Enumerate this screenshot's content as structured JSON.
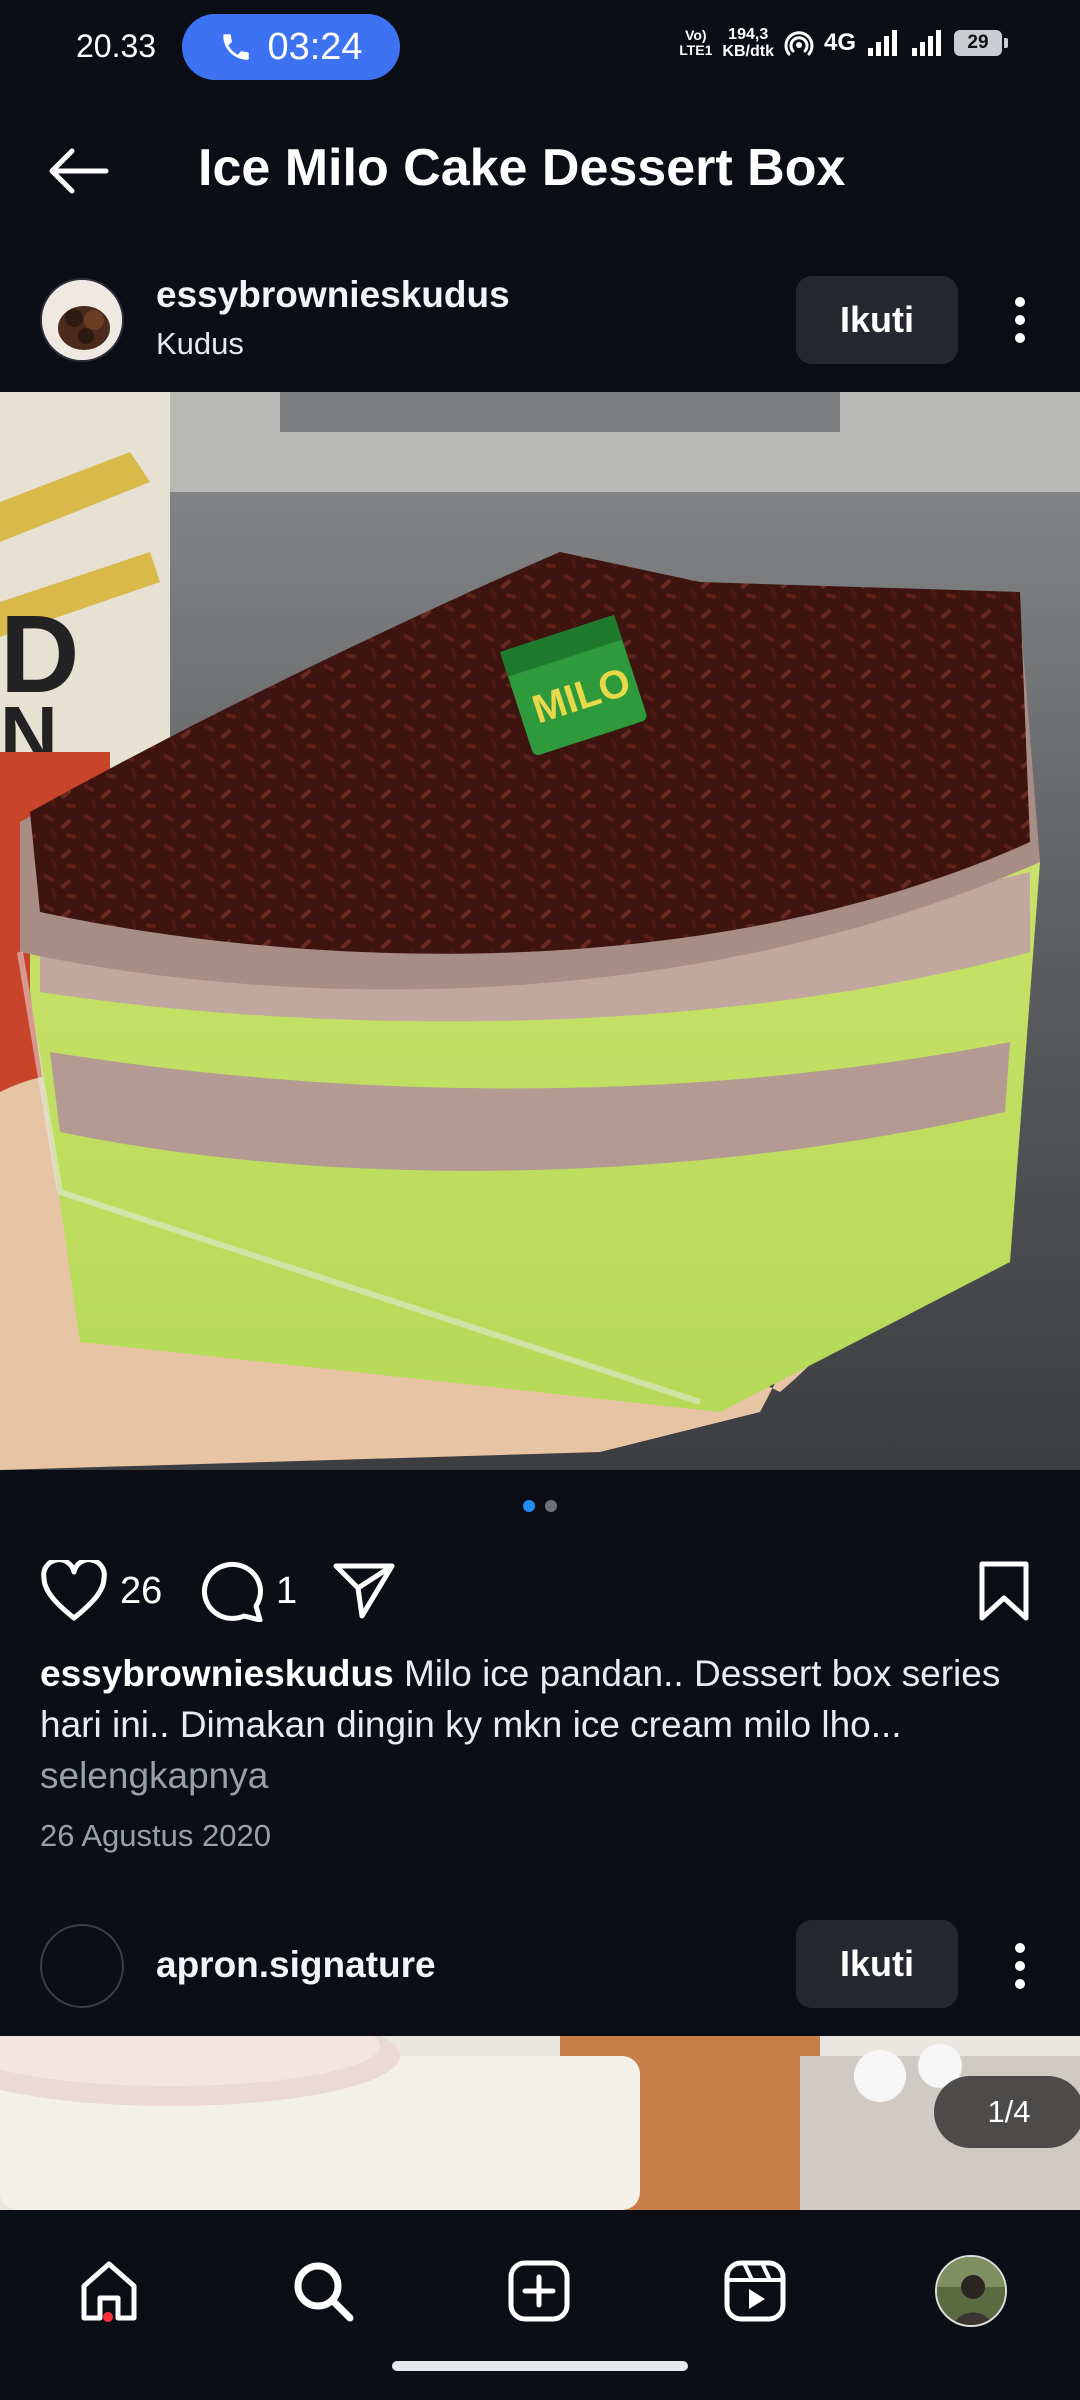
{
  "status_bar": {
    "time": "20.33",
    "call_timer": "03:24",
    "volte_line1": "Vo)",
    "volte_line2": "LTE1",
    "net_speed_line1": "194,3",
    "net_speed_line2": "KB/dtk",
    "network": "4G",
    "battery": "29"
  },
  "header": {
    "title": "Ice Milo Cake Dessert Box"
  },
  "post": {
    "username": "essybrownieskudus",
    "location": "Kudus",
    "follow_label": "Ikuti",
    "likes": "26",
    "comments": "1",
    "caption_user": "essybrownieskudus",
    "caption_text": " Milo ice pandan.. Dessert box series hari ini.. Dimakan dingin ky mkn ice cream milo lho...",
    "more_label": "selengkapnya",
    "date": "26 Agustus 2020",
    "carousel": {
      "count": 2,
      "active": 1
    }
  },
  "post2": {
    "username": "apron.signature",
    "follow_label": "Ikuti",
    "counter": "1/4"
  },
  "bottom_nav": {
    "items": [
      "home-icon",
      "search-icon",
      "create-icon",
      "reels-icon",
      "profile-avatar"
    ]
  },
  "colors": {
    "background": "#0b0f15",
    "call_pill": "#3d72f2",
    "active_dot": "#1e8cf0",
    "notification_dot": "#ff3040",
    "follow_button": "#25292f"
  }
}
